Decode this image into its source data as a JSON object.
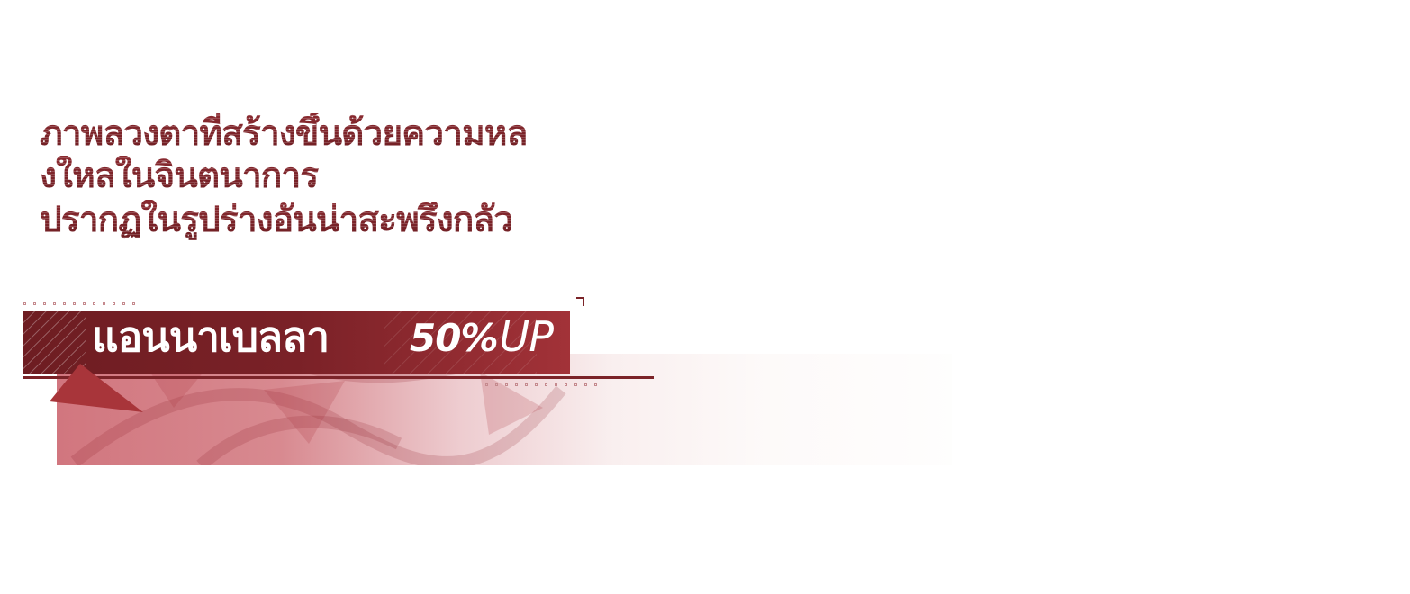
{
  "headline": {
    "line1": "ภาพลวงตาที่สร้างขึ้นด้วยความหล",
    "line2": "งใหลในจินตนาการ",
    "line3": "ปรากฏในรูปร่างอันน่าสะพรึงกลัว"
  },
  "banner": {
    "character_name": "แอนนาเบลลา",
    "boost_percent": "50%",
    "boost_label": "UP"
  },
  "colors": {
    "primary": "#7b2328",
    "plate_dark": "#6e1d22",
    "plate_light": "#a23238",
    "accent": "#a8353a"
  },
  "icons": {
    "boost_indicator": "up-arrow-icon"
  }
}
